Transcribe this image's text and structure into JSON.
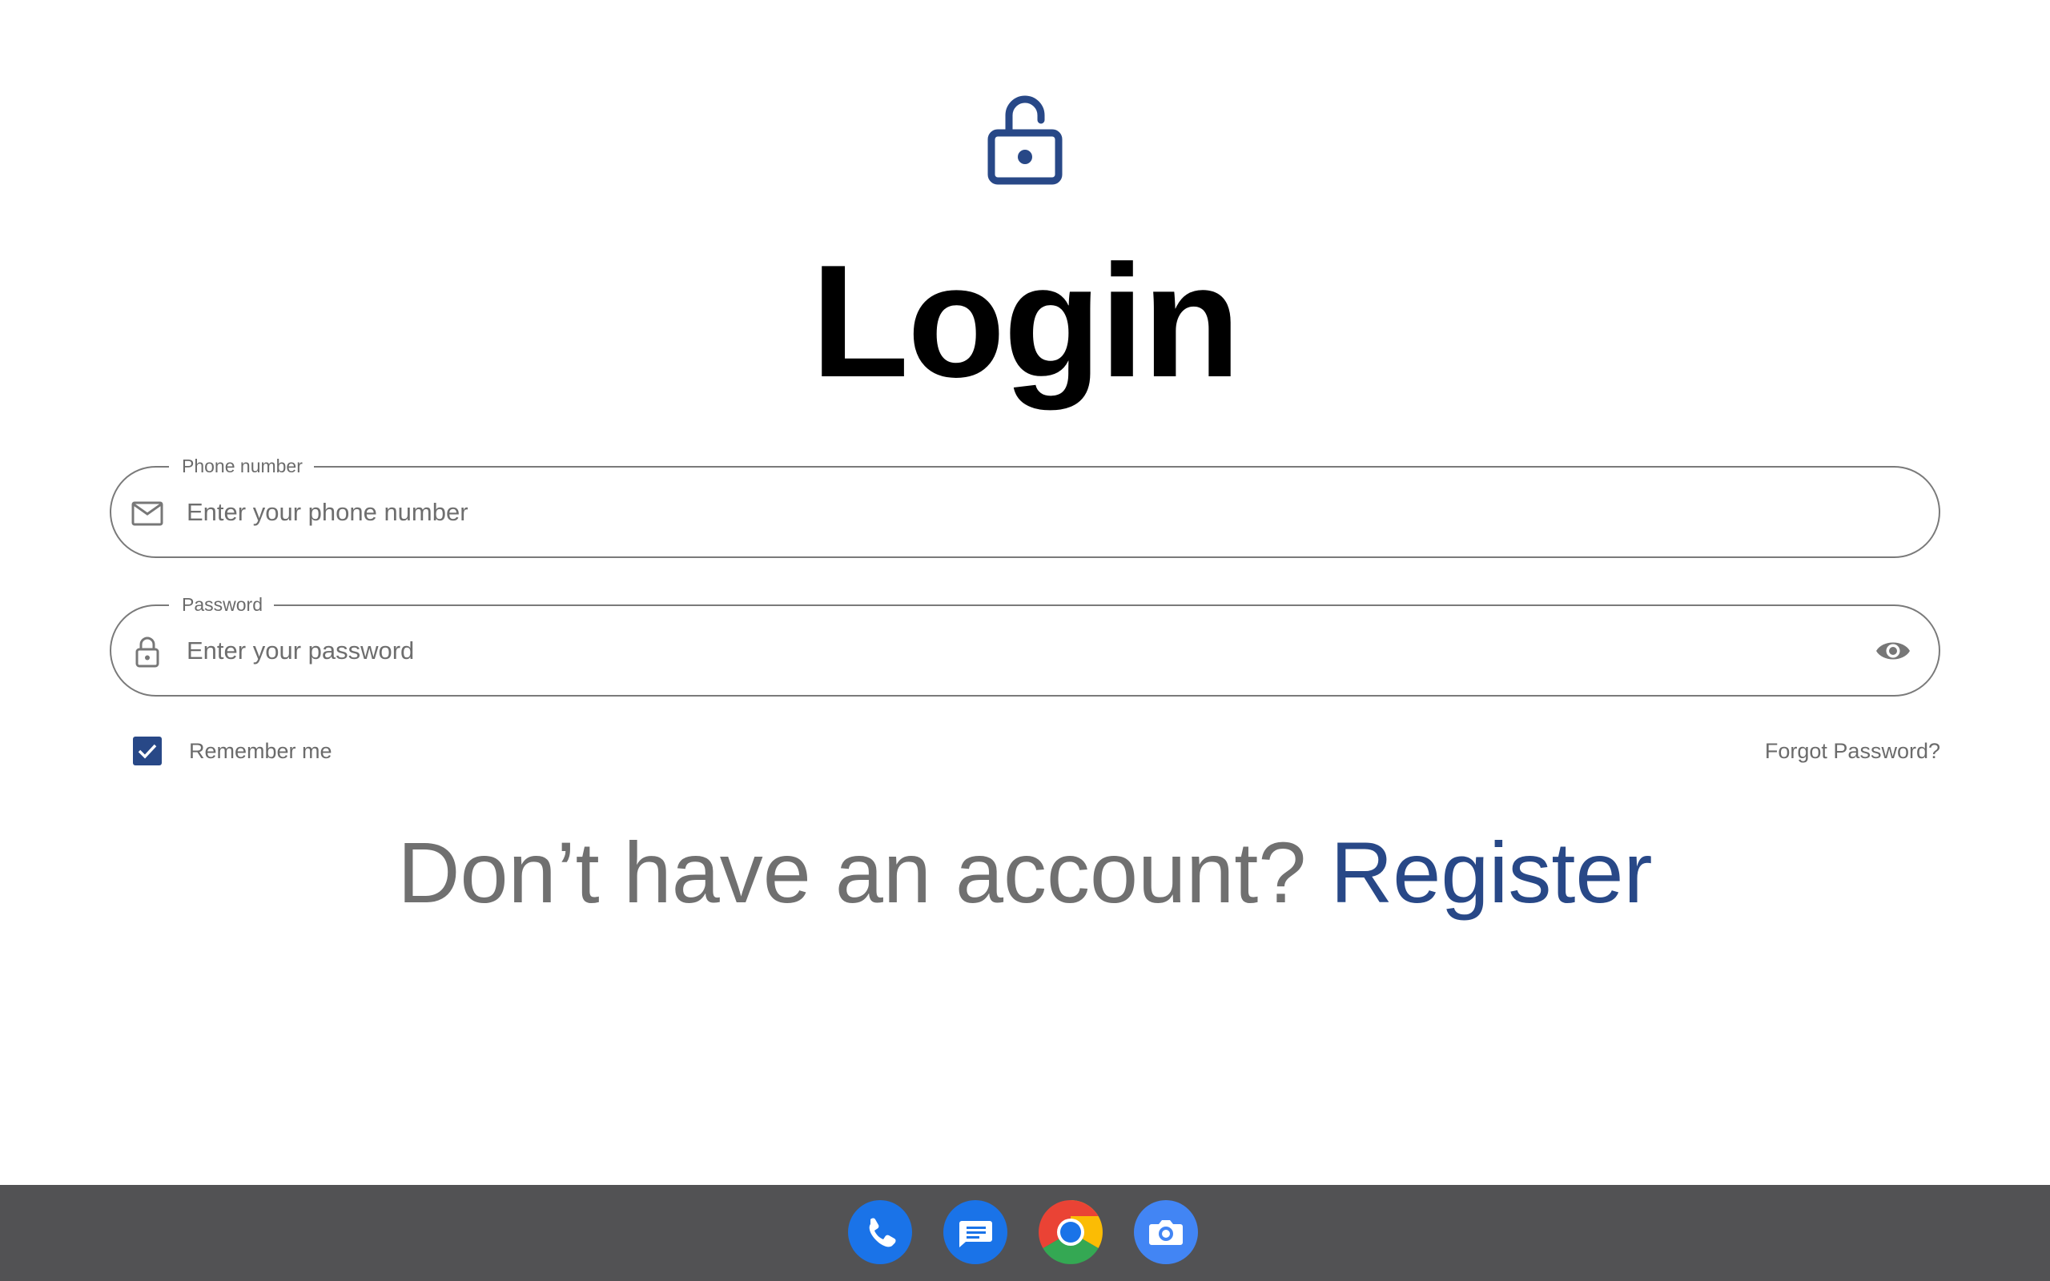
{
  "page": {
    "title": "Login"
  },
  "phone_field": {
    "legend": "Phone number",
    "placeholder": "Enter your phone number",
    "icon": "mail-icon"
  },
  "password_field": {
    "legend": "Password",
    "placeholder": "Enter your password",
    "icon": "lock-icon",
    "toggle_icon": "eye-icon"
  },
  "remember": {
    "label": "Remember me",
    "checked": true
  },
  "forgot": {
    "label": "Forgot Password?"
  },
  "register": {
    "prompt": "Don’t have an account? ",
    "link_label": "Register"
  },
  "taskbar": {
    "apps": [
      "phone-app",
      "messages-app",
      "chrome-app",
      "camera-app"
    ]
  },
  "colors": {
    "accent": "#284887",
    "text_muted": "#6b6b6b",
    "taskbar": "#525254"
  }
}
